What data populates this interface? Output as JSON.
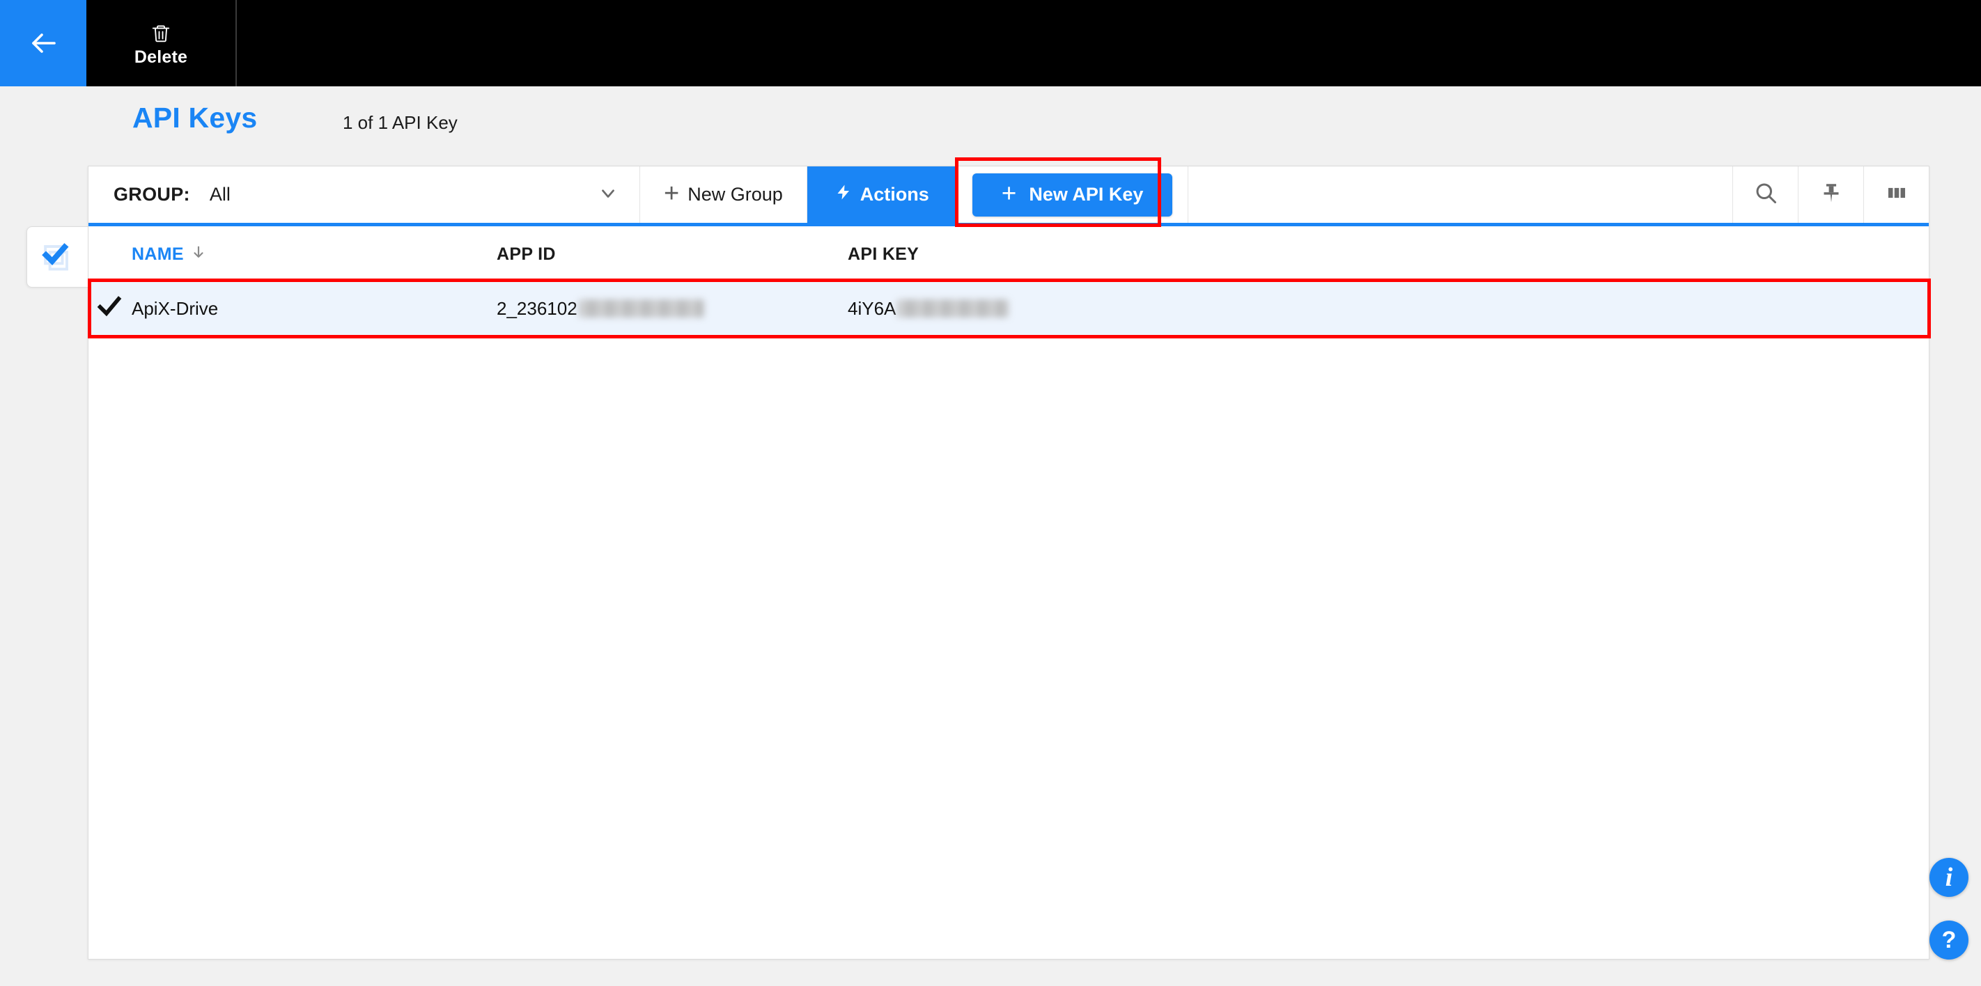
{
  "topbar": {
    "back_icon": "arrow-left-icon",
    "delete_label": "Delete",
    "delete_icon": "trash-icon"
  },
  "header": {
    "title": "API Keys",
    "record_count": "1 of 1 API Key"
  },
  "select_tab": {
    "icon": "select-all-icon"
  },
  "toolbar": {
    "group_label": "GROUP:",
    "group_value": "All",
    "group_chevron_icon": "chevron-down-icon",
    "new_group_label": "New Group",
    "new_group_icon": "plus-icon",
    "actions_label": "Actions",
    "actions_icon": "lightning-bolt-icon",
    "new_api_key_label": "New API Key",
    "new_api_key_icon": "plus-icon",
    "search_icon": "search-icon",
    "pin_icon": "pin-icon",
    "columns_icon": "columns-icon"
  },
  "table": {
    "columns": [
      {
        "key": "name",
        "label": "NAME",
        "sort_icon": "arrow-down-icon",
        "sorted": true
      },
      {
        "key": "appid",
        "label": "APP ID",
        "sorted": false
      },
      {
        "key": "apikey",
        "label": "API KEY",
        "sorted": false
      }
    ],
    "rows": [
      {
        "selected": true,
        "check_icon": "checkmark-icon",
        "name": "ApiX-Drive",
        "appid": "2_236102",
        "appid_redacted": true,
        "apikey": "4iY6A",
        "apikey_redacted": true
      }
    ]
  },
  "floating": {
    "info_label": "i",
    "help_label": "?"
  },
  "colors": {
    "accent": "#1a85f5",
    "highlight": "#ff0000",
    "row_selected": "#edf4fd",
    "topbar_bg": "#000000",
    "page_bg": "#f1f1f1"
  }
}
